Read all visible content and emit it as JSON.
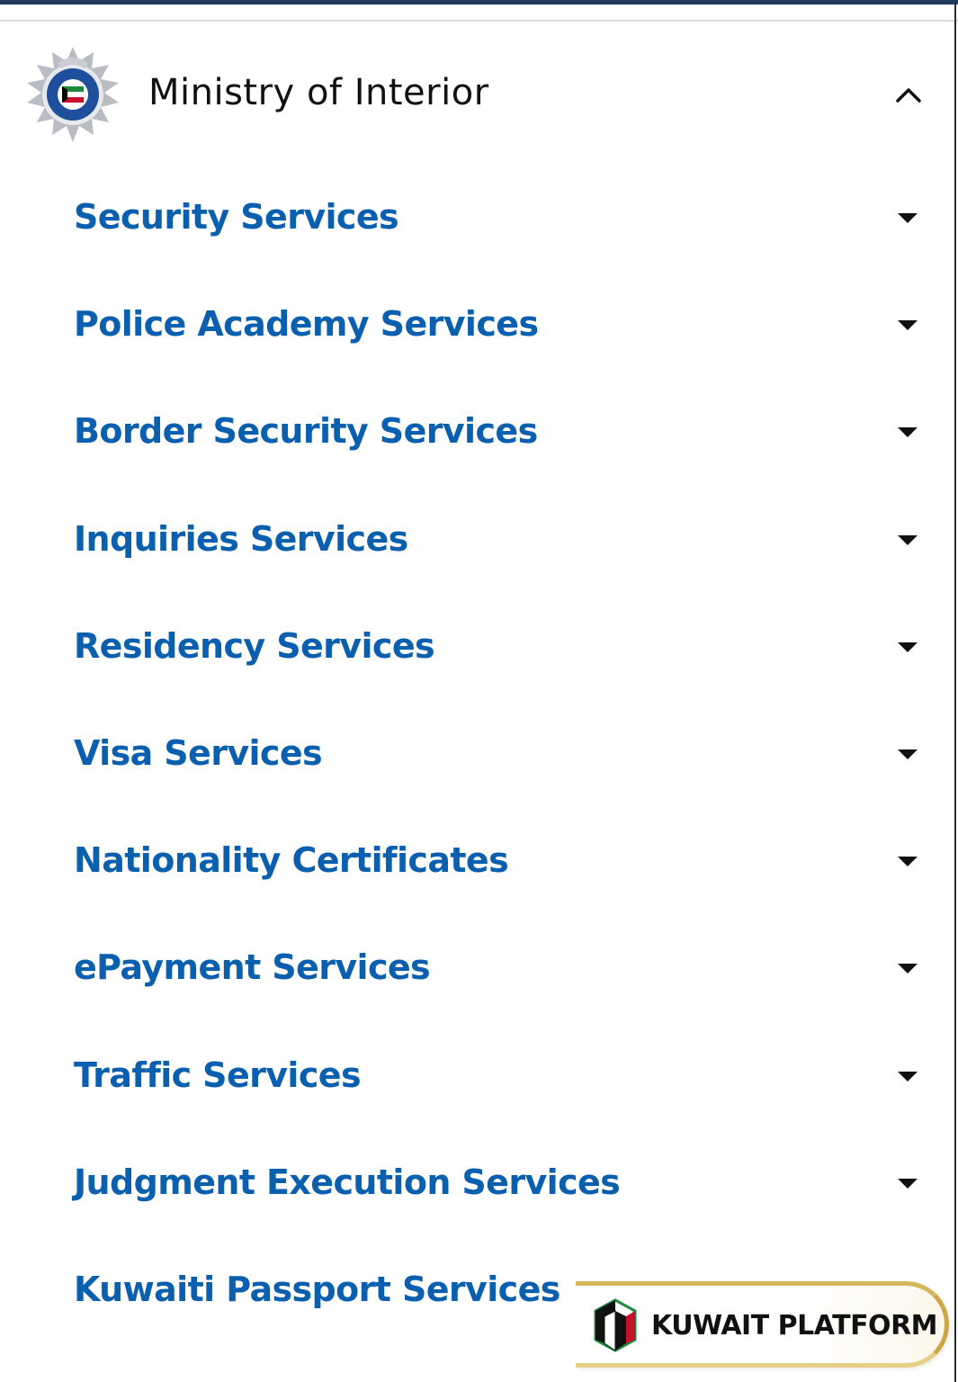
{
  "header": {
    "title": "Ministry of Interior",
    "logo_icon": "kuwait-police-emblem",
    "collapse_icon": "chevron-up-icon"
  },
  "menu": {
    "items": [
      {
        "label": "Security Services"
      },
      {
        "label": "Police Academy Services"
      },
      {
        "label": "Border Security Services"
      },
      {
        "label": "Inquiries Services"
      },
      {
        "label": "Residency Services"
      },
      {
        "label": "Visa Services"
      },
      {
        "label": "Nationality Certificates"
      },
      {
        "label": "ePayment Services"
      },
      {
        "label": "Traffic Services"
      },
      {
        "label": "Judgment Execution Services"
      },
      {
        "label": "Kuwaiti Passport Services"
      }
    ],
    "expand_icon": "caret-down-icon"
  },
  "badge": {
    "label": "KUWAIT PLATFORM",
    "icon": "kuwait-platform-logo"
  },
  "colors": {
    "link_blue": "#0a5fae",
    "top_bar": "#1f3b5c",
    "gold": "#d7b75c"
  }
}
